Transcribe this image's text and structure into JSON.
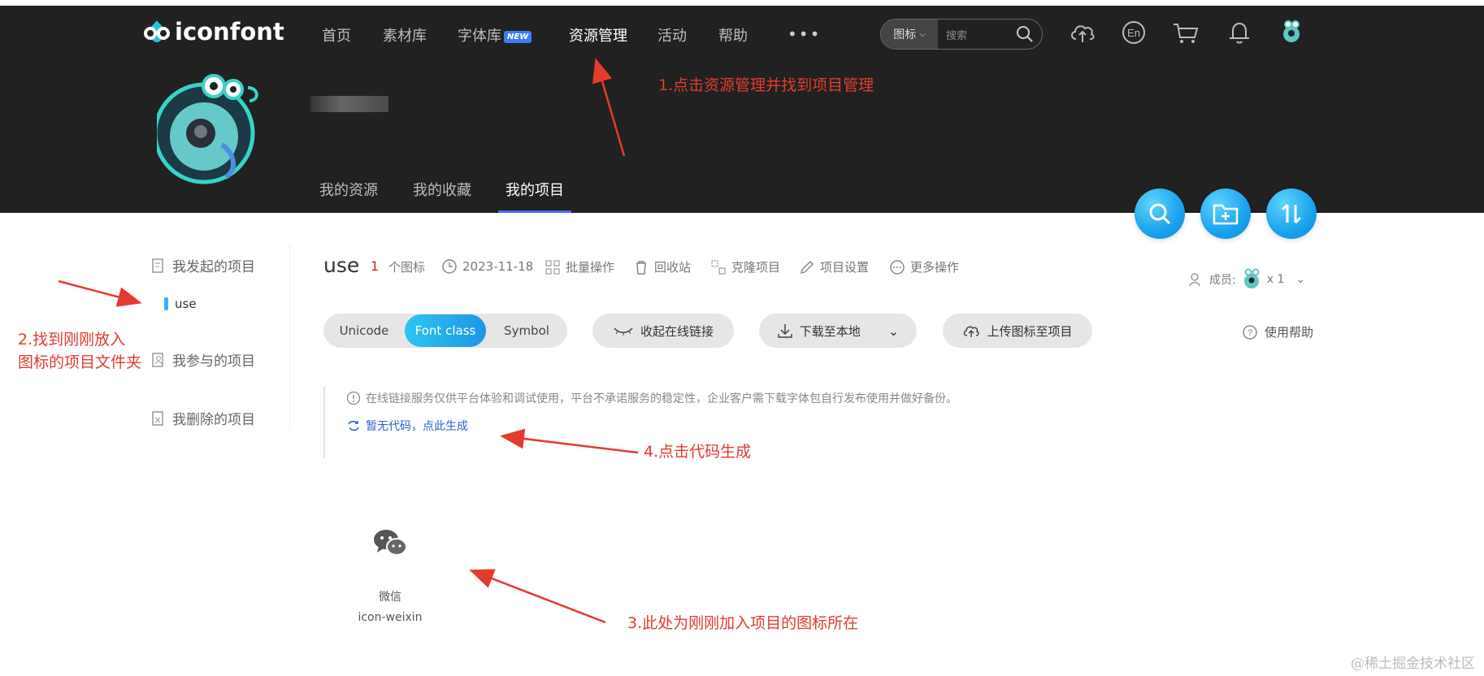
{
  "header": {
    "logo_text": "iconfont",
    "nav": [
      "首页",
      "素材库",
      "字体库",
      "资源管理",
      "活动",
      "帮助"
    ],
    "new_badge": "NEW",
    "more": "•••",
    "search_type": "图标",
    "search_placeholder": "搜索"
  },
  "profile_tabs": [
    "我的资源",
    "我的收藏",
    "我的项目"
  ],
  "sidebar": {
    "started": "我发起的项目",
    "use_item": "use",
    "joined": "我参与的项目",
    "deleted": "我删除的项目"
  },
  "project": {
    "name": "use",
    "count": "1",
    "count_unit": "个图标",
    "date": "2023-11-18",
    "actions": [
      "批量操作",
      "回收站",
      "克隆项目",
      "项目设置",
      "更多操作"
    ],
    "member_label": "成员:",
    "member_count": "x 1"
  },
  "toolbar": {
    "segments": [
      "Unicode",
      "Font class",
      "Symbol"
    ],
    "collapse": "收起在线链接",
    "download": "下载至本地",
    "upload": "上传图标至项目",
    "help": "使用帮助"
  },
  "notice": "在线链接服务仅供平台体验和调试使用，平台不承诺服务的稳定性，企业客户需下载字体包自行发布使用并做好备份。",
  "generate": "暂无代码，点此生成",
  "icon": {
    "name": "微信",
    "code": "icon-weixin"
  },
  "annotations": {
    "a1": "1.点击资源管理并找到项目管理",
    "a2_line1": "2.找到刚刚放入",
    "a2_line2": "图标的项目文件夹",
    "a3": "3.此处为刚刚加入项目的图标所在",
    "a4": "4.点击代码生成"
  },
  "watermark": "@稀土掘金技术社区",
  "colors": {
    "header_bg": "#212121",
    "accent": "#1e95e6",
    "annotation": "#e33b2e"
  }
}
